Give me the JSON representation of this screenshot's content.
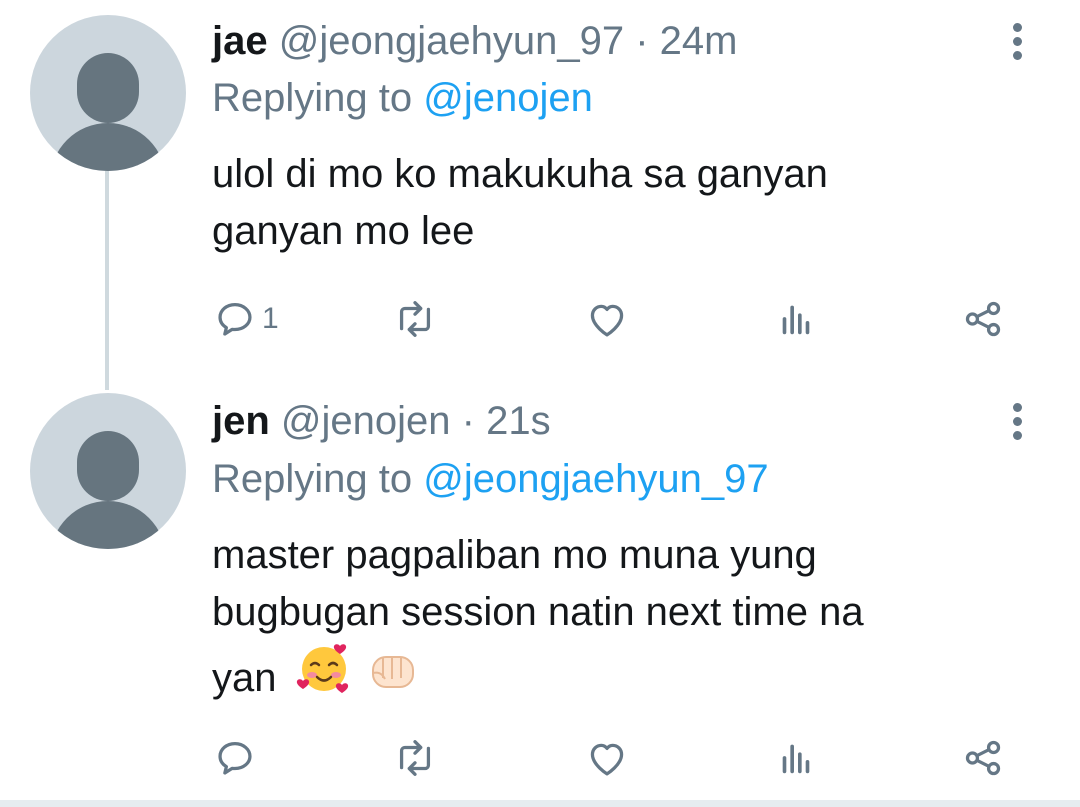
{
  "tweets": [
    {
      "display_name": "jae",
      "handle": "@jeongjaehyun_97",
      "separator": "·",
      "time": "24m",
      "replying_prefix": "Replying to",
      "replying_to": "@jenojen",
      "text_line1": "ulol di mo ko makukuha sa ganyan",
      "text_line2": "ganyan mo lee",
      "reply_count": "1"
    },
    {
      "display_name": "jen",
      "handle": "@jenojen",
      "separator": "·",
      "time": "21s",
      "replying_prefix": "Replying to",
      "replying_to": "@jeongjaehyun_97",
      "text_line1": "master pagpaliban mo muna yung",
      "text_line2": "bugbugan session natin next time na",
      "text_line3": "yan",
      "emojis": [
        "smiling-face-with-hearts",
        "oncoming-fist"
      ],
      "reply_count": ""
    }
  ],
  "icons": [
    "reply-icon",
    "retweet-icon",
    "like-icon",
    "analytics-icon",
    "share-icon",
    "more-icon",
    "avatar-placeholder"
  ],
  "colors": {
    "link": "#1da1f2",
    "secondary_text": "#657786",
    "icon": "#657786",
    "avatar_bg": "#ccd6dd",
    "thread_line": "#cfd9de"
  }
}
